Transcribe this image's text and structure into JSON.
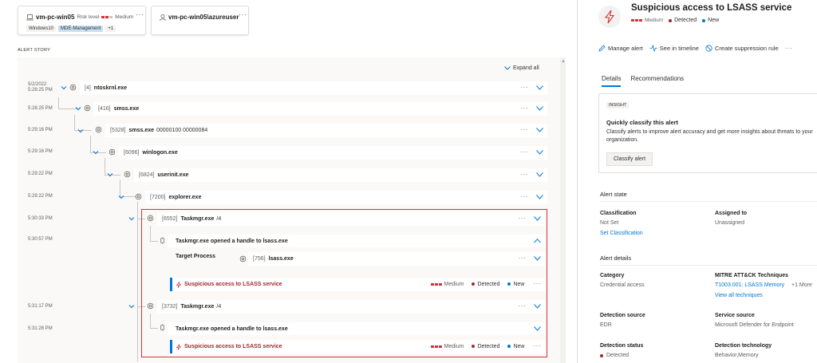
{
  "devices": {
    "machine": {
      "name": "vm-pc-win05",
      "risk_label": "Risk level",
      "risk_value": "Medium",
      "tags": [
        "Windows10",
        "MDE-Management",
        "+1"
      ]
    },
    "user": {
      "name": "vm-pc-win05\\azureuser"
    },
    "more": "···"
  },
  "story": {
    "label": "ALERT STORY",
    "expand_all": "Expand all",
    "processes": [
      {
        "time": "5/2/2022",
        "time2": "5:28:25 PM",
        "pid": "[4]",
        "name": "ntoskrnl.exe",
        "args": ""
      },
      {
        "time": "5:28:25 PM",
        "pid": "[416]",
        "name": "smss.exe",
        "args": ""
      },
      {
        "time": "5:29:16 PM",
        "pid": "[5328]",
        "name": "smss.exe",
        "args": "00000100 00000084"
      },
      {
        "time": "5:29:16 PM",
        "pid": "[6096]",
        "name": "winlogon.exe",
        "args": ""
      },
      {
        "time": "5:29:22 PM",
        "pid": "[6824]",
        "name": "userinit.exe",
        "args": ""
      },
      {
        "time": "5:29:22 PM",
        "pid": "[7200]",
        "name": "explorer.exe",
        "args": ""
      },
      {
        "time": "5:30:33 PM",
        "pid": "[6552]",
        "name": "Taskmgr.exe",
        "args": "/4"
      },
      {
        "time": "5:31:17 PM",
        "pid": "[3732]",
        "name": "Taskmgr.exe",
        "args": "/4"
      }
    ],
    "events": [
      {
        "time": "5:30:57 PM",
        "title": "Taskmgr.exe opened a handle to lsass.exe"
      },
      {
        "time": "5:31:28 PM",
        "title": "Taskmgr.exe opened a handle to lsass.exe"
      }
    ],
    "target": {
      "label": "Target Process",
      "pid": "[756]",
      "name": "lsass.exe"
    },
    "alerts": [
      {
        "title": "Suspicious access to LSASS service",
        "severity": "Medium",
        "status": "Detected",
        "classification": "New"
      },
      {
        "title": "Suspicious access to LSASS service",
        "severity": "Medium",
        "status": "Detected",
        "classification": "New"
      }
    ],
    "more": "···"
  },
  "panel": {
    "title": "Suspicious access to LSASS service",
    "severity": "Medium",
    "status": "Detected",
    "classification": "New",
    "toolbar": {
      "manage": "Manage alert",
      "timeline": "See in timeline",
      "suppression": "Create suppression rule",
      "more": "···"
    },
    "tabs": [
      "Details",
      "Recommendations"
    ],
    "insight": {
      "badge": "INSIGHT",
      "title": "Quickly classify this alert",
      "text": "Classify alerts to improve alert accuracy and get more insights about threats to your organization.",
      "button": "Classify alert"
    },
    "alert_state": {
      "heading": "Alert state",
      "classification_label": "Classification",
      "classification_value": "Not Set",
      "set_classification": "Set Classification",
      "assigned_label": "Assigned to",
      "assigned_value": "Unassigned"
    },
    "alert_details": {
      "heading": "Alert details",
      "category_label": "Category",
      "category_value": "Credential access",
      "mitre_label": "MITRE ATT&CK Techniques",
      "mitre_value": "T1003.001: LSASS Memory",
      "mitre_more": "+1 More",
      "view_all": "View all techniques",
      "detection_source_label": "Detection source",
      "detection_source_value": "EDR",
      "service_source_label": "Service source",
      "service_source_value": "Microsoft Defender for Endpoint",
      "detection_status_label": "Detection status",
      "detection_status_value": "Detected",
      "detection_tech_label": "Detection technology",
      "detection_tech_value": "Behavior,Memory"
    }
  },
  "colors": {
    "accent": "#0078d4",
    "danger": "#a4262c",
    "severity": "#d13438",
    "highlight": "#d13438"
  }
}
